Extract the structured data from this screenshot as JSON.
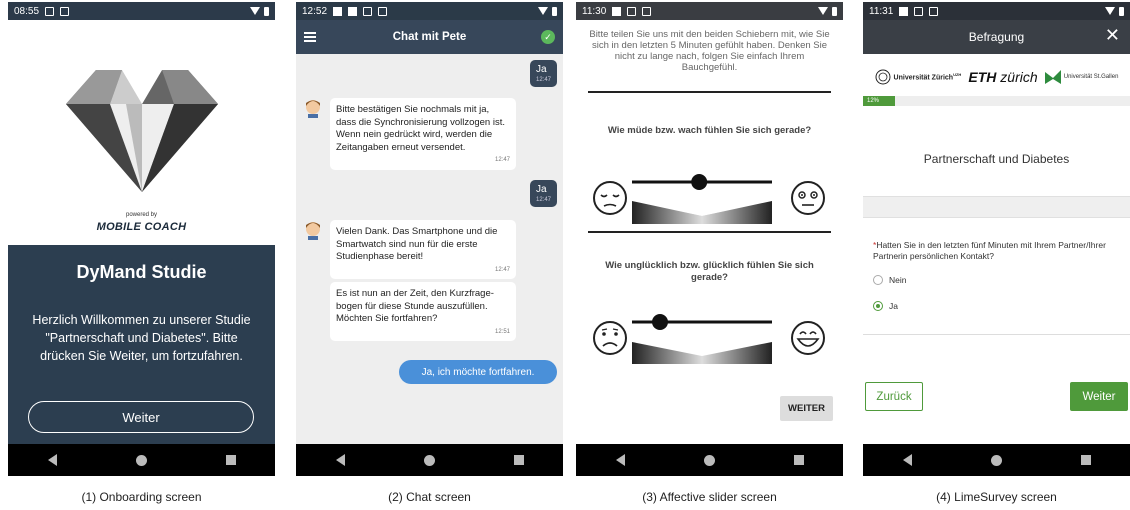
{
  "screens": [
    {
      "status": {
        "time": "08:55",
        "icon": "p-icon"
      },
      "logo": {
        "powered_by": "powered by",
        "brand": "MOBILE COACH"
      },
      "title": "DyMand Studie",
      "welcome": "Herzlich Willkommen zu unserer Studie \"Partnerschaft und Diabetes\". Bitte drücken Sie Weiter, um fortzufahren.",
      "button": "Weiter",
      "caption": "(1) Onboarding screen"
    },
    {
      "status": {
        "time": "12:52"
      },
      "appbar_title": "Chat mit Pete",
      "messages": [
        {
          "from": "user",
          "text": "Ja",
          "time": "12:47"
        },
        {
          "from": "coach",
          "text": "Bitte bestätigen Sie nochmals mit ja, dass die Synchronisierung vollzogen ist. Wenn nein gedrückt wird, werden die Zeitangaben erneut versendet.",
          "time": "12:47"
        },
        {
          "from": "user",
          "text": "Ja",
          "time": "12:47"
        },
        {
          "from": "coach",
          "text": "Vielen Dank. Das Smartphone und die Smartwatch sind nun für die erste Studienphase bereit!",
          "time": "12:47"
        },
        {
          "from": "coach",
          "text": "Es ist nun an der Zeit, den Kurzfrage-bogen für diese Stunde auszufüllen. Möchten Sie fortfahren?",
          "time": "12:51"
        }
      ],
      "answer_button": "Ja, ich möchte fortfahren.",
      "caption": "(2) Chat screen"
    },
    {
      "status": {
        "time": "11:30"
      },
      "intro": "Bitte teilen Sie uns mit den beiden Schiebern mit, wie Sie sich in den letzten 5 Minuten gefühlt haben. Denken Sie nicht zu lange nach, folgen Sie einfach Ihrem Bauchgefühl.",
      "questions": [
        {
          "text": "Wie müde bzw. wach fühlen Sie sich gerade?",
          "value": 0.48
        },
        {
          "text": "Wie unglücklich bzw. glücklich fühlen Sie sich gerade?",
          "value": 0.2
        }
      ],
      "button": "WEITER",
      "caption": "(3) Affective slider screen"
    },
    {
      "status": {
        "time": "11:31"
      },
      "appbar_title": "Befragung",
      "close": "✕",
      "logos": {
        "uzh": "Universität Zürich",
        "uzh_sup": "UZH",
        "eth_a": "ETH",
        "eth_b": "zürich",
        "hsg": "Universität St.Gallen"
      },
      "progress": {
        "label": "12%",
        "value": 0.12
      },
      "section_title": "Partnerschaft und Diabetes",
      "question": "Hatten Sie in den letzten fünf Minuten mit Ihrem Partner/Ihrer Partnerin persönlichen Kontakt?",
      "options": [
        {
          "label": "Nein",
          "selected": false
        },
        {
          "label": "Ja",
          "selected": true
        }
      ],
      "back": "Zurück",
      "next": "Weiter",
      "caption": "(4) LimeSurvey screen"
    }
  ],
  "colors": {
    "dark_blue": "#2c3e50",
    "chat_bubble": "#37475a",
    "chat_answer": "#4a90d9",
    "lime_green": "#4f9a3b"
  }
}
